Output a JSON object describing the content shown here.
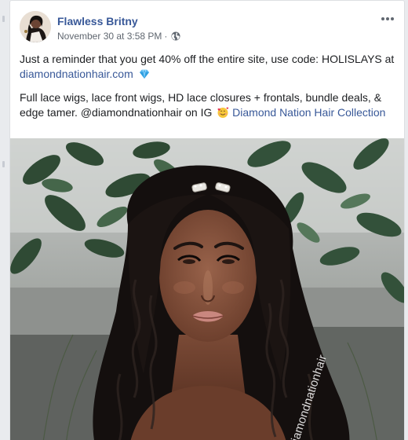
{
  "post": {
    "author": "Flawless Britny",
    "timestamp": "November 30 at 3:58 PM",
    "separator": "·",
    "privacy_icon": "globe-icon",
    "more_icon": "more-options-icon",
    "paragraph1": {
      "text": "Just a reminder that you get 40% off the entire site, use code: HOLISLAYS at ",
      "link": "diamondnationhair.com",
      "emoji": "gem-icon"
    },
    "paragraph2": {
      "text": "Full lace wigs, lace front wigs, HD lace closures + frontals, bundle deals, & edge tamer. @diamondnationhair on IG ",
      "emoji": "smiling-face-with-hearts-icon",
      "page_link": "Diamond Nation Hair Collection"
    },
    "photo": {
      "watermark": "diamondnationhair"
    }
  },
  "colors": {
    "link": "#385898",
    "text": "#1c1e21",
    "meta": "#606770",
    "card_bg": "#ffffff",
    "page_bg": "#e9ebee"
  }
}
